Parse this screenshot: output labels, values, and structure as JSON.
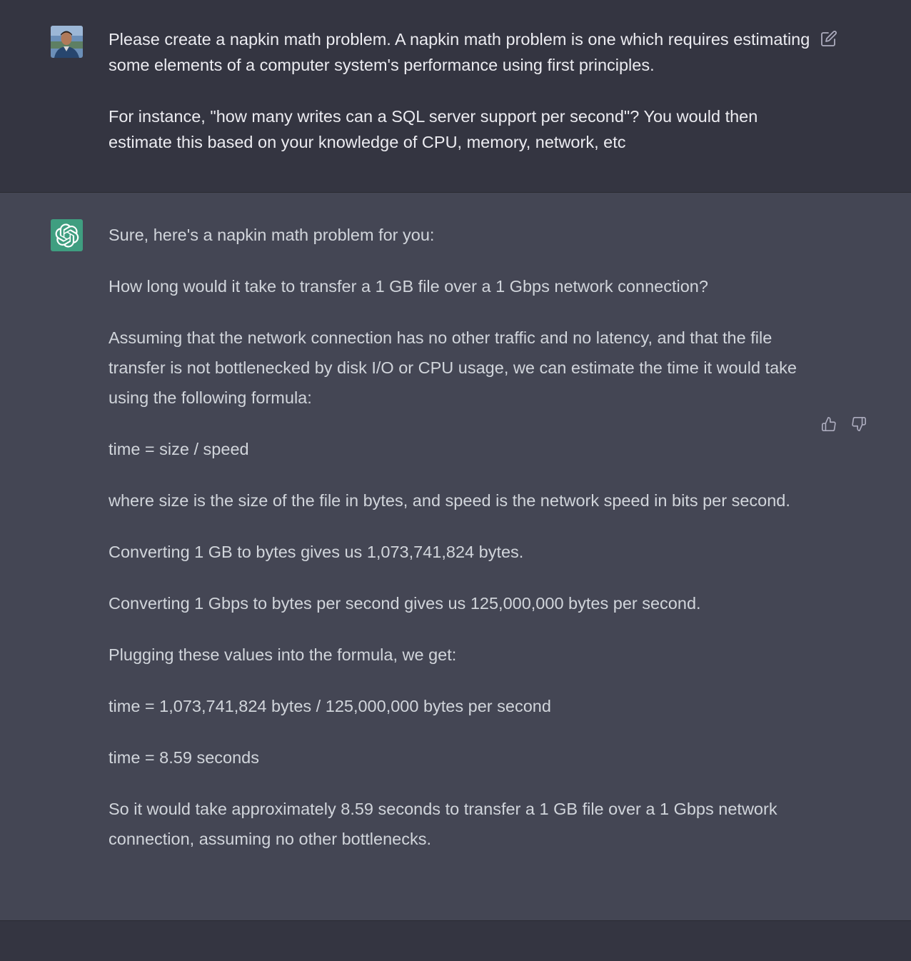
{
  "user_turn": {
    "avatar_icon": "user-photo-avatar",
    "paragraphs": [
      "Please create a napkin math problem. A napkin math problem is one which requires estimating some elements of a computer system's performance using first principles.",
      "For instance, \"how many writes can a SQL server support per second\"? You would then estimate this based on your knowledge of CPU, memory, network, etc"
    ],
    "edit_icon": "edit-icon"
  },
  "assistant_turn": {
    "avatar_icon": "openai-logo-icon",
    "paragraphs": [
      "Sure, here's a napkin math problem for you:",
      "How long would it take to transfer a 1 GB file over a 1 Gbps network connection?",
      "Assuming that the network connection has no other traffic and no latency, and that the file transfer is not bottlenecked by disk I/O or CPU usage, we can estimate the time it would take using the following formula:",
      "time = size / speed",
      "where size is the size of the file in bytes, and speed is the network speed in bits per second.",
      "Converting 1 GB to bytes gives us 1,073,741,824 bytes.",
      "Converting 1 Gbps to bytes per second gives us 125,000,000 bytes per second.",
      "Plugging these values into the formula, we get:",
      "time = 1,073,741,824 bytes / 125,000,000 bytes per second",
      "time = 8.59 seconds",
      "So it would take approximately 8.59 seconds to transfer a 1 GB file over a 1 Gbps network connection, assuming no other bottlenecks."
    ],
    "thumbs_up_icon": "thumbs-up-icon",
    "thumbs_down_icon": "thumbs-down-icon"
  },
  "colors": {
    "page_bg": "#343541",
    "assistant_bg": "#444654",
    "bot_avatar_bg": "#3f9e80",
    "text": "#ececf1",
    "icon": "#acacbe"
  }
}
